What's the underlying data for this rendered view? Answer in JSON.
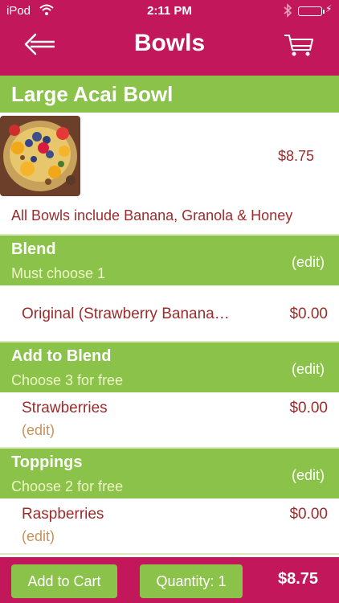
{
  "status_bar": {
    "carrier": "iPod",
    "time": "2:11 PM"
  },
  "nav": {
    "title": "Bowls",
    "back_icon": "back-arrow-icon",
    "cart_icon": "cart-icon"
  },
  "item": {
    "name": "Large Acai Bowl",
    "price": "$8.75",
    "note": "All Bowls include Banana, Granola & Honey"
  },
  "sections": [
    {
      "title": "Blend",
      "subtitle": "Must choose 1",
      "edit_label": "(edit)",
      "choices": [
        {
          "name": "Original (Strawberry Banana…",
          "price": "$0.00"
        }
      ]
    },
    {
      "title": "Add to Blend",
      "subtitle": "Choose 3 for free",
      "edit_label": "(edit)",
      "choices": [
        {
          "name": "Strawberries",
          "price": "$0.00",
          "edit_label": "(edit)"
        }
      ]
    },
    {
      "title": "Toppings",
      "subtitle": "Choose 2 for free",
      "edit_label": "(edit)",
      "choices": [
        {
          "name": "Raspberries",
          "price": "$0.00",
          "edit_label": "(edit)"
        }
      ]
    }
  ],
  "footer": {
    "add_to_cart": "Add to Cart",
    "quantity": "Quantity: 1",
    "total": "$8.75"
  },
  "colors": {
    "magenta": "#c2185b",
    "green": "#8bc34a",
    "price_red": "#9c2b2b",
    "edit_tan": "#c7915a"
  }
}
